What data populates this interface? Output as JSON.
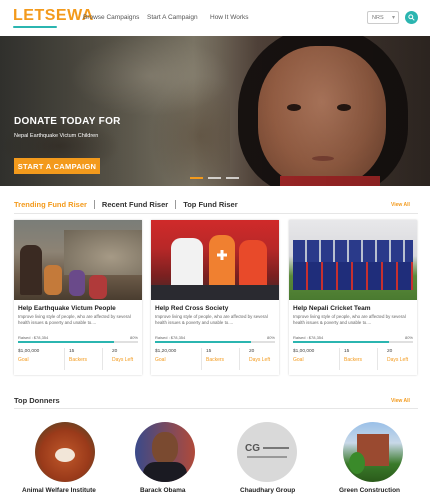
{
  "brand": {
    "logo_text": "LETSEWA"
  },
  "nav": {
    "items": [
      {
        "label": "Browse Campaigns"
      },
      {
        "label": "Start A Campaign"
      },
      {
        "label": "How It Works"
      }
    ]
  },
  "language": {
    "selected": "NRS"
  },
  "hero": {
    "title": "DONATE TODAY FOR",
    "subtitle": "Nepal Earthquake Victum Children",
    "cta_label": "START A CAMPAIGN",
    "slides": 3,
    "active_slide": 1
  },
  "tabs": [
    {
      "label": "Trending Fund Riser",
      "active": true
    },
    {
      "label": "Recent Fund Riser",
      "active": false
    },
    {
      "label": "Top Fund Riser",
      "active": false
    }
  ],
  "view_all_label": "View All",
  "campaigns": [
    {
      "title": "Help Earthquake Victum People",
      "description": "Improve living style of people, who are affected by several health issues & poverty and unable to....",
      "raised_text": "Raised : $78,354",
      "percent_text": "80%",
      "progress": 0.8,
      "goal_value": "$1,00,000",
      "goal_label": "Goal",
      "backers_value": "15",
      "backers_label": "Backers",
      "days_value": "20",
      "days_label": "Days Left"
    },
    {
      "title": "Help Red Cross Society",
      "description": "Improve living style of people, who are affected by several health issues & poverty and unable to....",
      "raised_text": "Raised : $78,354",
      "percent_text": "80%",
      "progress": 0.8,
      "goal_value": "$1,20,000",
      "goal_label": "Goal",
      "backers_value": "15",
      "backers_label": "Backers",
      "days_value": "20",
      "days_label": "Days Left"
    },
    {
      "title": "Help Nepali Cricket Team",
      "description": "Improve living style of people, who are affected by several health issues & poverty and unable to....",
      "raised_text": "Raised : $78,354",
      "percent_text": "80%",
      "progress": 0.8,
      "goal_value": "$1,00,000",
      "goal_label": "Goal",
      "backers_value": "15",
      "backers_label": "Backers",
      "days_value": "20",
      "days_label": "Days Left"
    }
  ],
  "donors": {
    "title": "Top Donners",
    "items": [
      {
        "name": "Animal Welfare Institute"
      },
      {
        "name": "Barack Obama"
      },
      {
        "name": "Chaudhary Group"
      },
      {
        "name": "Green Construction"
      }
    ]
  },
  "colors": {
    "accent": "#f39a1c",
    "teal": "#2bb5b0"
  }
}
